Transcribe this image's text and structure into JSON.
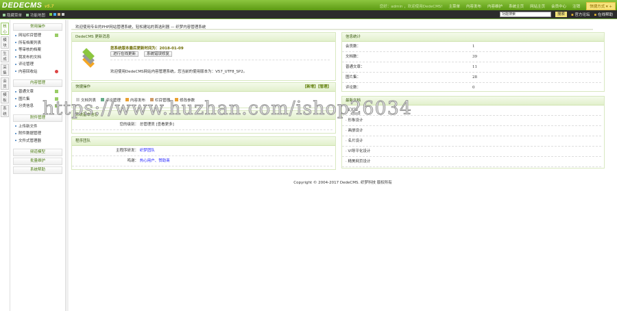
{
  "header": {
    "logo": "DEDECMS",
    "version": "v5.7",
    "greeting": "您好：admin ，欢迎使用DedeCMS!",
    "nav": [
      "主菜单",
      "内容发布",
      "内容维护",
      "系统主页",
      "网站主页",
      "会员中心",
      "注销"
    ],
    "quick": "快捷方式 ▾ +"
  },
  "toolbar": {
    "left": [
      "隐藏菜单",
      "功能地图"
    ],
    "search_value": "功能搜索",
    "search_button": "搜索",
    "links": [
      "官方论坛",
      "在线帮助"
    ]
  },
  "tabs": [
    "核心",
    "模块",
    "生成",
    "采集",
    "会员",
    "模板",
    "系统"
  ],
  "menu": [
    {
      "title": "常用操作",
      "items": [
        "网站栏目管理",
        "所有档案列表",
        "等审核的档案",
        "我发布的文档",
        "评论管理",
        "内容回收站"
      ]
    },
    {
      "title": "内容管理",
      "items": [
        "普通文章",
        "图片集",
        "分类信息"
      ]
    },
    {
      "title": "附件管理",
      "items": [
        "上传新文件",
        "附件数据管理",
        "文件式管理器"
      ]
    },
    {
      "title": "频道模型",
      "items": []
    },
    {
      "title": "批量维护",
      "items": []
    },
    {
      "title": "系统帮助",
      "items": []
    }
  ],
  "welcome": "欢迎使用专业的PHP网站管理系统，轻松建站的首选利器 — 织梦内容管理系统",
  "update": {
    "title": "DedeCMS 更新消息",
    "headline": "您系统版本最后更新时间为：2018-01-09",
    "buttons": [
      "进行在线更新",
      "系统错误修复"
    ],
    "text": "欢迎使用DedeCMS网站内容管理系统，您当前的使用版本为：V57_UTF8_SP2。"
  },
  "quick_ops": {
    "title": "快捷操作",
    "actions": "【新增】【管理】",
    "items": [
      "文档列表",
      "评论管理",
      "内容发布",
      "栏目管理",
      "修改参数"
    ]
  },
  "sysinfo": {
    "title": "系统基本信息",
    "label": "您的级别：",
    "value": "总管理员 [查看更多]"
  },
  "team": {
    "title": "程序团队",
    "rows": [
      {
        "label": "主程序研发：",
        "value": "织梦团队"
      },
      {
        "label": "鸣谢：",
        "value": "热心用户、赞助商"
      }
    ]
  },
  "stats": {
    "title": "信息统计",
    "rows": [
      {
        "label": "会员数：",
        "value": "1"
      },
      {
        "label": "文档数：",
        "value": "39"
      },
      {
        "label": "普通文章：",
        "value": "11"
      },
      {
        "label": "图片集：",
        "value": "28"
      },
      {
        "label": "评论数：",
        "value": "0"
      }
    ]
  },
  "latest": {
    "title": "最新文档",
    "items": [
      "· 幻灯3",
      "· 形象设计",
      "· 画册设计",
      "· 名片设计",
      "· VI导平化设计",
      "· 精美网页设计"
    ]
  },
  "footer": "Copyright © 2004-2017 DedeCMS. 织梦科技 版权所有",
  "watermark": "https://www.huzhan.com/ishop26034"
}
